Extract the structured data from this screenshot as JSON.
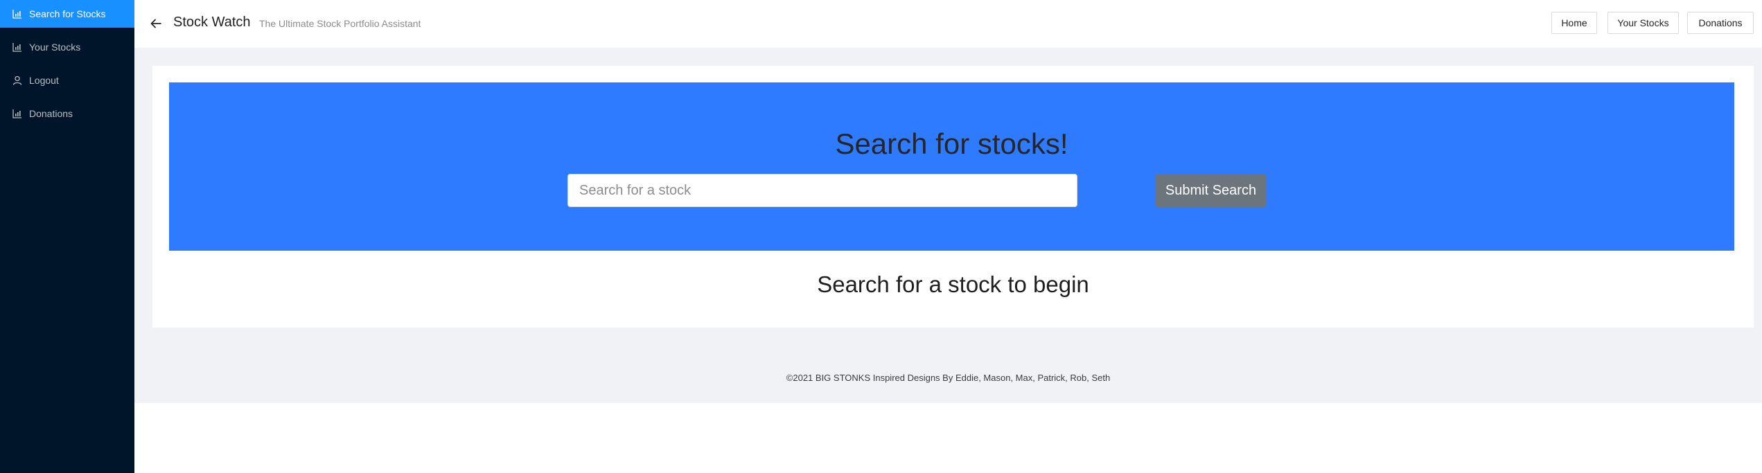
{
  "sidebar": {
    "items": [
      {
        "label": "Search for Stocks",
        "icon": "bar-chart-icon",
        "active": true
      },
      {
        "label": "Your Stocks",
        "icon": "bar-chart-icon",
        "active": false
      },
      {
        "label": "Logout",
        "icon": "user-icon",
        "active": false
      },
      {
        "label": "Donations",
        "icon": "bar-chart-icon",
        "active": false
      }
    ]
  },
  "header": {
    "title": "Stock Watch",
    "subtitle": "The Ultimate Stock Portfolio Assistant",
    "buttons": [
      "Home",
      "Your Stocks",
      "Donations"
    ]
  },
  "search": {
    "heading": "Search for stocks!",
    "placeholder": "Search for a stock",
    "value": "",
    "submit_label": "Submit Search"
  },
  "main": {
    "prompt": "Search for a stock to begin"
  },
  "footer": {
    "text": "©2021 BIG STONKS Inspired Designs By Eddie, Mason, Max, Patrick, Rob, Seth"
  },
  "colors": {
    "sidebar_bg": "#001529",
    "active_item": "#1890ff",
    "banner": "#2f7bff",
    "submit_button": "#6c757d",
    "content_bg": "#f0f2f5"
  }
}
